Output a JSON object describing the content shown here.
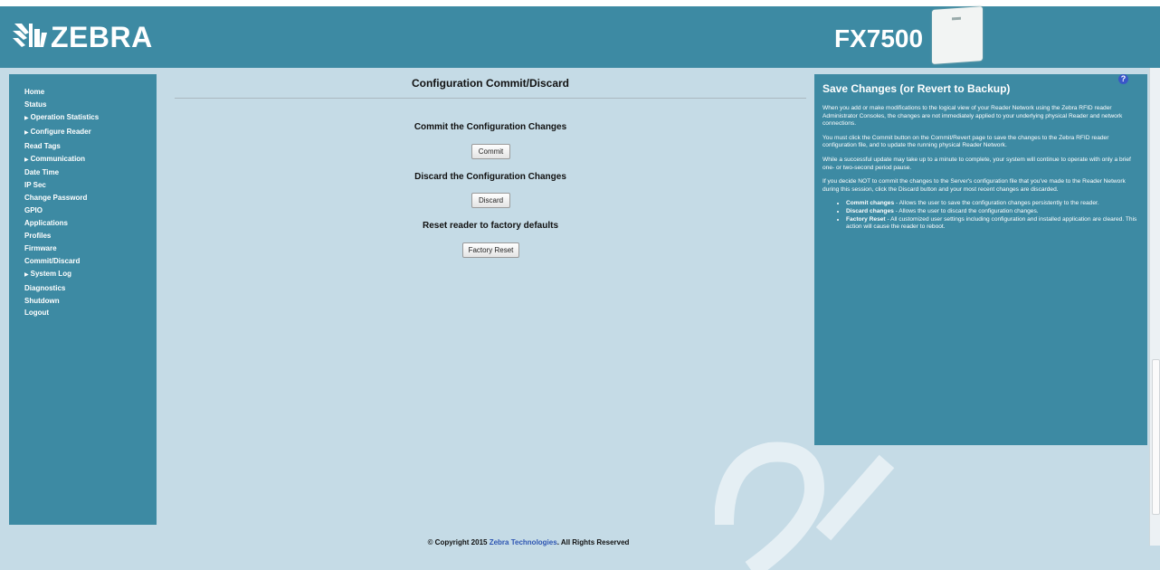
{
  "header": {
    "logo_text": "ZEBRA",
    "model": "FX7500"
  },
  "sidebar": {
    "items": [
      {
        "label": "Home",
        "expandable": false
      },
      {
        "label": "Status",
        "expandable": false
      },
      {
        "label": "Operation Statistics",
        "expandable": true
      },
      {
        "label": "Configure Reader",
        "expandable": true
      },
      {
        "label": "Read Tags",
        "expandable": false
      },
      {
        "label": "Communication",
        "expandable": true
      },
      {
        "label": "Date Time",
        "expandable": false
      },
      {
        "label": "IP Sec",
        "expandable": false
      },
      {
        "label": "Change Password",
        "expandable": false
      },
      {
        "label": "GPIO",
        "expandable": false
      },
      {
        "label": "Applications",
        "expandable": false
      },
      {
        "label": "Profiles",
        "expandable": false
      },
      {
        "label": "Firmware",
        "expandable": false
      },
      {
        "label": "Commit/Discard",
        "expandable": false
      },
      {
        "label": "System Log",
        "expandable": true
      },
      {
        "label": "Diagnostics",
        "expandable": false
      },
      {
        "label": "Shutdown",
        "expandable": false
      },
      {
        "label": "Logout",
        "expandable": false
      }
    ]
  },
  "main": {
    "title": "Configuration Commit/Discard",
    "commit_heading": "Commit the Configuration Changes",
    "commit_button": "Commit",
    "discard_heading": "Discard the Configuration Changes",
    "discard_button": "Discard",
    "reset_heading": "Reset reader to factory defaults",
    "reset_button": "Factory Reset"
  },
  "help": {
    "icon": "?",
    "title": "Save Changes (or Revert to Backup)",
    "paragraphs": [
      "When you add or make modifications to the logical view of your Reader Network using the Zebra RFID reader Administrator Consoles, the changes are not immediately applied to your underlying physical Reader and network connections.",
      "You must click the Commit button on the Commit/Revert page to save the changes to the Zebra RFID reader configuration file, and to update the running physical Reader Network.",
      "While a successful update may take up to a minute to complete, your system will continue to operate with only a brief one- or two-second period pause.",
      "If you decide NOT to commit the changes to the Server's configuration file that you've made to the Reader Network during this session, click the Discard button and your most recent changes are discarded."
    ],
    "bullets": [
      {
        "term": "Commit changes",
        "text": " - Allows the user to save the configuration changes persistently to the reader."
      },
      {
        "term": "Discard changes",
        "text": " - Allows the user to discard the configuration changes."
      },
      {
        "term": "Factory Reset",
        "text": " - All customized user settings including configuration and installed application are cleared. This action will cause the reader to reboot."
      }
    ]
  },
  "footer": {
    "prefix": "© Copyright 2015 ",
    "link": "Zebra Technologies",
    "suffix": ". All Rights Reserved"
  }
}
